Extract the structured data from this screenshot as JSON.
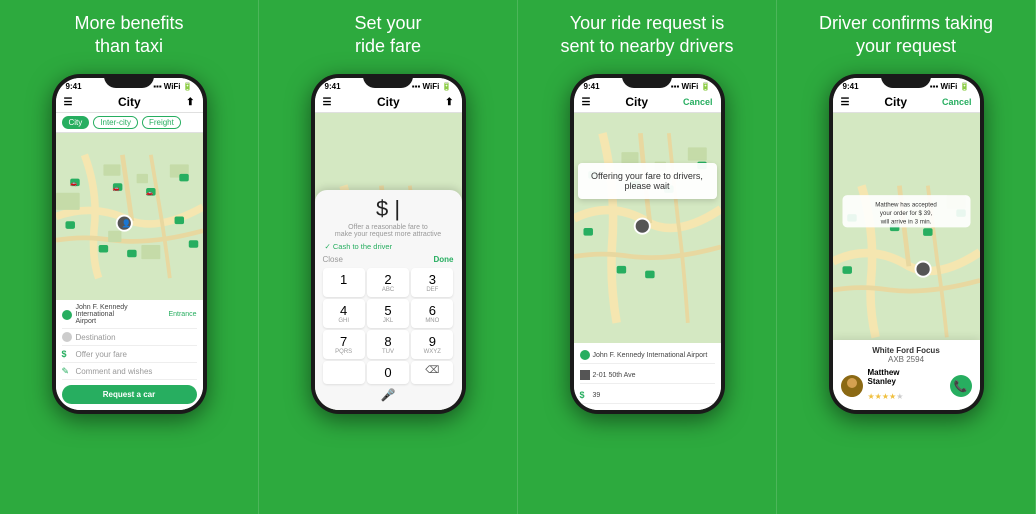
{
  "panels": [
    {
      "id": "panel1",
      "title": "More benefits\nthan taxi",
      "phone": {
        "time": "9:41",
        "appTitle": "City",
        "tabs": [
          "City",
          "Inter-city",
          "Freight"
        ],
        "activeTab": 0,
        "formRows": [
          {
            "icon": "location",
            "placeholder": "John F. Kennedy International Airport"
          },
          {
            "icon": "circle",
            "placeholder": "Destination"
          },
          {
            "icon": "dollar",
            "placeholder": "Offer your fare"
          },
          {
            "icon": "comment",
            "placeholder": "Comment and wishes"
          }
        ],
        "buttonLabel": "Request a car"
      }
    },
    {
      "id": "panel2",
      "title": "Set your\nride fare",
      "phone": {
        "time": "9:41",
        "appTitle": "City",
        "fareValue": "$ |",
        "fareHint": "Offer a reasonable fare to\nmake your request more attractive",
        "cashLabel": "✓ Cash to the driver",
        "closeLabel": "Close",
        "doneLabel": "Done",
        "numpad": [
          "1",
          "2",
          "3",
          "4",
          "5",
          "6",
          "7",
          "8",
          "9",
          "0"
        ]
      }
    },
    {
      "id": "panel3",
      "title": "Your ride request is\nsent to nearby drivers",
      "phone": {
        "time": "9:41",
        "appTitle": "City",
        "cancelLabel": "Cancel",
        "waitingText": "Offering your fare to drivers,\nplease wait",
        "infoRows": [
          {
            "icon": "location",
            "text": "John F. Kennedy International Airport"
          },
          {
            "icon": "circle",
            "text": "2-01 50th Ave"
          },
          {
            "icon": "dollar",
            "text": "39"
          }
        ]
      }
    },
    {
      "id": "panel4",
      "title": "Driver confirms taking\nyour request",
      "phone": {
        "time": "9:41",
        "appTitle": "City",
        "cancelLabel": "Cancel",
        "confirmText": "Matthew has accepted\nyour order for $ 39,\nwill arrive in 3 min.",
        "vehicleName": "White Ford Focus",
        "plate": "AXB 2594",
        "driverName": "Matthew\nStanley",
        "stars": 4.5
      }
    }
  ],
  "colors": {
    "green": "#27ae60",
    "bg": "#2daa3e"
  }
}
